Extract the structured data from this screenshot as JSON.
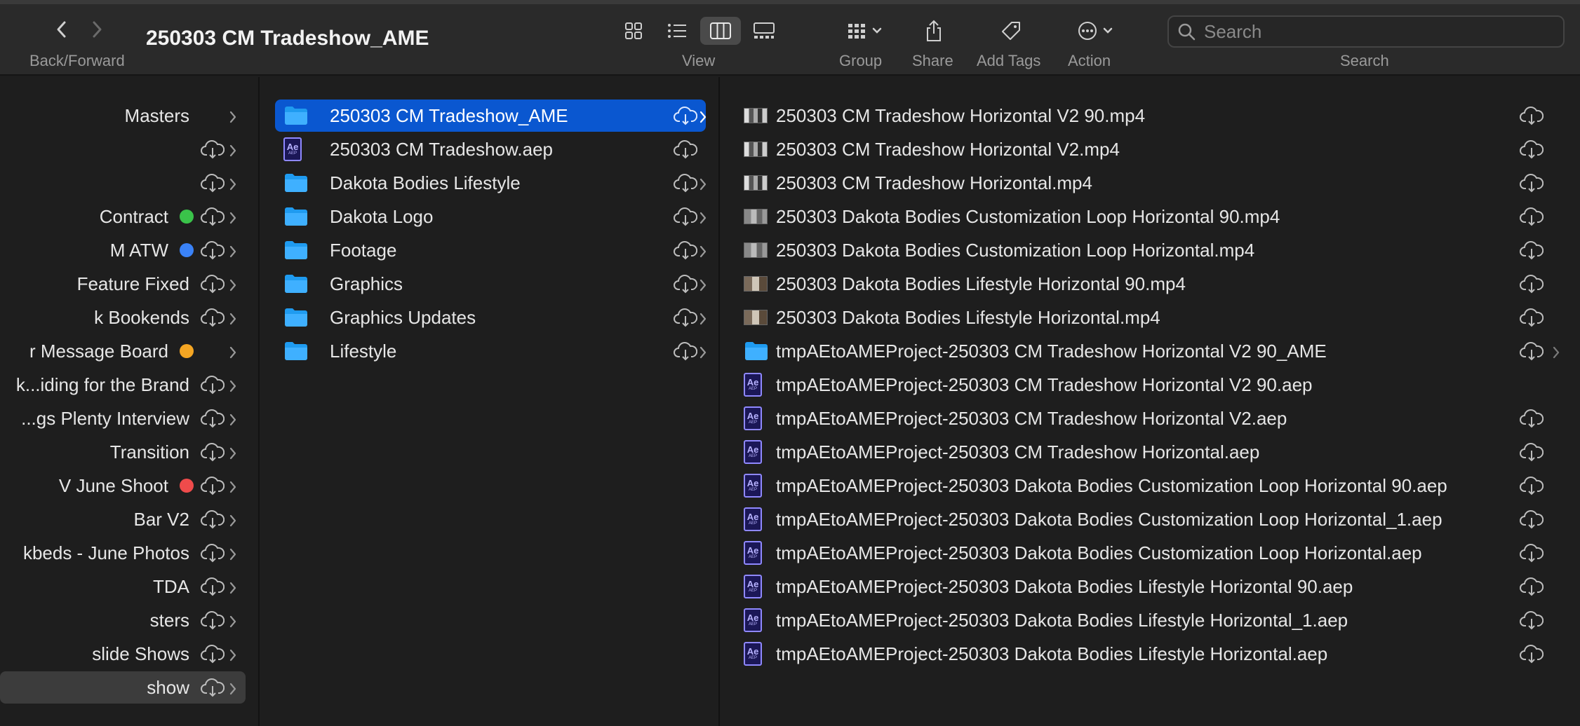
{
  "toolbar": {
    "title": "250303 CM Tradeshow_AME",
    "back_forward_label": "Back/Forward",
    "view_label": "View",
    "group_label": "Group",
    "share_label": "Share",
    "add_tags_label": "Add Tags",
    "action_label": "Action",
    "search_label": "Search",
    "search_placeholder": "Search"
  },
  "colors": {
    "selection": "#0a57d0",
    "tag_green": "#3ac34a",
    "tag_blue": "#3a82f7",
    "tag_orange": "#f5a623",
    "tag_red": "#ef4b4b"
  },
  "sidebar": {
    "items": [
      {
        "label": "Masters",
        "tag": null,
        "cloud": false
      },
      {
        "label": "",
        "tag": null,
        "cloud": true
      },
      {
        "label": "",
        "tag": null,
        "cloud": true
      },
      {
        "label": "Contract",
        "tag": "green",
        "cloud": true
      },
      {
        "label": "M ATW",
        "tag": "blue",
        "cloud": true
      },
      {
        "label": "Feature Fixed",
        "tag": null,
        "cloud": true
      },
      {
        "label": "k Bookends",
        "tag": null,
        "cloud": true
      },
      {
        "label": "r Message Board",
        "tag": "orange",
        "cloud": false
      },
      {
        "label": "k...iding for the Brand",
        "tag": null,
        "cloud": true
      },
      {
        "label": "...gs Plenty Interview",
        "tag": null,
        "cloud": true
      },
      {
        "label": "Transition",
        "tag": null,
        "cloud": true
      },
      {
        "label": "V June Shoot",
        "tag": "red",
        "cloud": true
      },
      {
        "label": "Bar V2",
        "tag": null,
        "cloud": true
      },
      {
        "label": "kbeds - June Photos",
        "tag": null,
        "cloud": true
      },
      {
        "label": "TDA",
        "tag": null,
        "cloud": true
      },
      {
        "label": "sters",
        "tag": null,
        "cloud": true
      },
      {
        "label": "slide Shows",
        "tag": null,
        "cloud": true
      },
      {
        "label": "show",
        "tag": null,
        "cloud": true,
        "selected": true
      }
    ]
  },
  "column2": {
    "items": [
      {
        "label": "250303 CM Tradeshow_AME",
        "kind": "folder",
        "selected": true,
        "chevron": true
      },
      {
        "label": "250303 CM Tradeshow.aep",
        "kind": "aep",
        "chevron": false
      },
      {
        "label": "Dakota Bodies Lifestyle",
        "kind": "folder",
        "chevron": true
      },
      {
        "label": "Dakota Logo",
        "kind": "folder",
        "chevron": true
      },
      {
        "label": "Footage",
        "kind": "folder",
        "chevron": true
      },
      {
        "label": "Graphics",
        "kind": "folder",
        "chevron": true
      },
      {
        "label": "Graphics Updates",
        "kind": "folder",
        "chevron": true
      },
      {
        "label": "Lifestyle",
        "kind": "folder",
        "chevron": true
      }
    ]
  },
  "column3": {
    "items": [
      {
        "label": "250303 CM Tradeshow Horizontal V2 90.mp4",
        "kind": "mp4a",
        "cloud": true
      },
      {
        "label": "250303 CM Tradeshow Horizontal V2.mp4",
        "kind": "mp4a",
        "cloud": true
      },
      {
        "label": "250303 CM Tradeshow Horizontal.mp4",
        "kind": "mp4a",
        "cloud": true
      },
      {
        "label": "250303 Dakota Bodies Customization Loop Horizontal 90.mp4",
        "kind": "mp4b",
        "cloud": true
      },
      {
        "label": "250303 Dakota Bodies Customization Loop Horizontal.mp4",
        "kind": "mp4b",
        "cloud": true
      },
      {
        "label": "250303 Dakota Bodies Lifestyle  Horizontal 90.mp4",
        "kind": "mp4c",
        "cloud": true
      },
      {
        "label": "250303 Dakota Bodies Lifestyle  Horizontal.mp4",
        "kind": "mp4c",
        "cloud": true
      },
      {
        "label": "tmpAEtoAMEProject-250303 CM Tradeshow Horizontal V2 90_AME",
        "kind": "folder",
        "cloud": true,
        "chevron": true
      },
      {
        "label": "tmpAEtoAMEProject-250303 CM Tradeshow Horizontal V2 90.aep",
        "kind": "aep",
        "cloud": false
      },
      {
        "label": "tmpAEtoAMEProject-250303 CM Tradeshow Horizontal V2.aep",
        "kind": "aep",
        "cloud": true
      },
      {
        "label": "tmpAEtoAMEProject-250303 CM Tradeshow Horizontal.aep",
        "kind": "aep",
        "cloud": true
      },
      {
        "label": "tmpAEtoAMEProject-250303 Dakota Bodies Customization Loop Horizontal 90.aep",
        "kind": "aep",
        "cloud": true
      },
      {
        "label": "tmpAEtoAMEProject-250303 Dakota Bodies Customization Loop Horizontal_1.aep",
        "kind": "aep",
        "cloud": true
      },
      {
        "label": "tmpAEtoAMEProject-250303 Dakota Bodies Customization Loop Horizontal.aep",
        "kind": "aep",
        "cloud": true
      },
      {
        "label": "tmpAEtoAMEProject-250303 Dakota Bodies Lifestyle  Horizontal 90.aep",
        "kind": "aep",
        "cloud": true
      },
      {
        "label": "tmpAEtoAMEProject-250303 Dakota Bodies Lifestyle  Horizontal_1.aep",
        "kind": "aep",
        "cloud": true
      },
      {
        "label": "tmpAEtoAMEProject-250303 Dakota Bodies Lifestyle  Horizontal.aep",
        "kind": "aep",
        "cloud": true
      }
    ]
  },
  "ae_icon": {
    "big": "Ae",
    "small": "AEP"
  }
}
